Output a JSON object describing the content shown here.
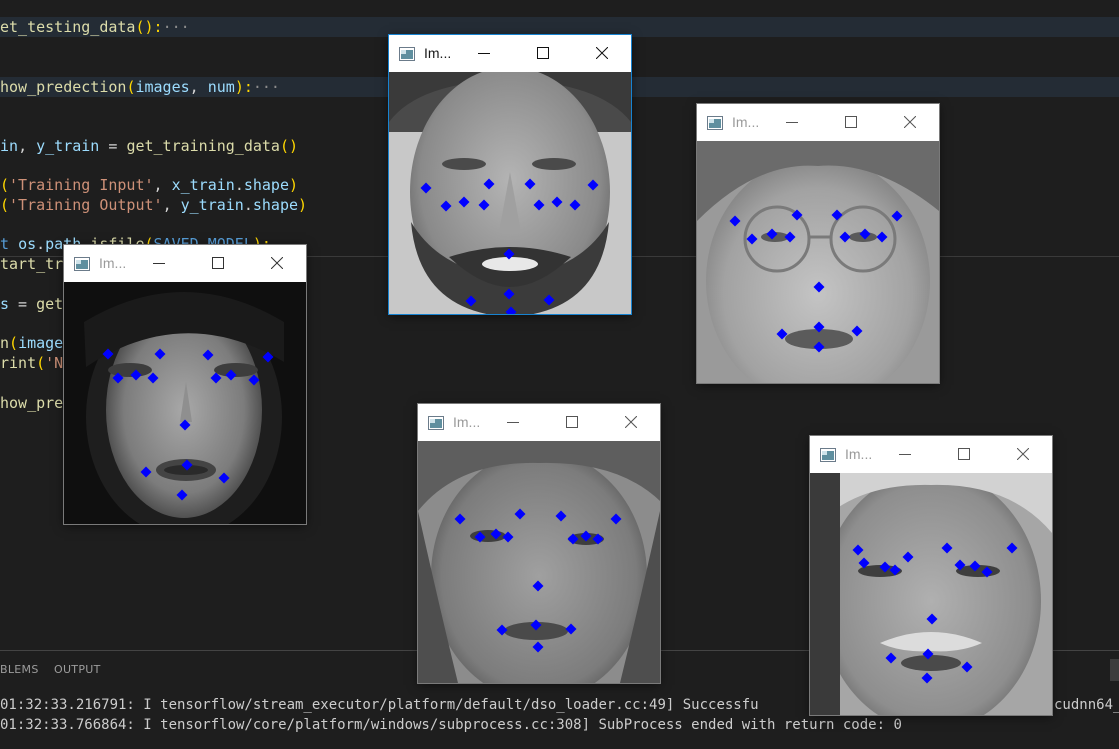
{
  "editor": {
    "lines": [
      {
        "parts": [
          {
            "t": "et_testing_data",
            "c": "fn"
          },
          {
            "t": "():",
            "c": "pn"
          },
          {
            "t": "···",
            "c": "fold"
          }
        ]
      },
      {
        "parts": [
          {
            "t": "how_predection",
            "c": "fn"
          },
          {
            "t": "(",
            "c": "pn"
          },
          {
            "t": "images",
            "c": "var"
          },
          {
            "t": ", ",
            "c": "txt"
          },
          {
            "t": "num",
            "c": "var"
          },
          {
            "t": "):",
            "c": "pn"
          },
          {
            "t": "···",
            "c": "fold"
          }
        ]
      },
      {
        "parts": [
          {
            "t": "in",
            "c": "var"
          },
          {
            "t": ", ",
            "c": "txt"
          },
          {
            "t": "y_train",
            "c": "var"
          },
          {
            "t": " = ",
            "c": "txt"
          },
          {
            "t": "get_training_data",
            "c": "fn"
          },
          {
            "t": "()",
            "c": "pn"
          }
        ]
      },
      {
        "parts": [
          {
            "t": "(",
            "c": "pn"
          },
          {
            "t": "'Training Input'",
            "c": "str"
          },
          {
            "t": ", ",
            "c": "txt"
          },
          {
            "t": "x_train",
            "c": "var"
          },
          {
            "t": ".",
            "c": "txt"
          },
          {
            "t": "shape",
            "c": "var"
          },
          {
            "t": ")",
            "c": "pn"
          }
        ]
      },
      {
        "parts": [
          {
            "t": "(",
            "c": "pn"
          },
          {
            "t": "'Training Output'",
            "c": "str"
          },
          {
            "t": ", ",
            "c": "txt"
          },
          {
            "t": "y_train",
            "c": "var"
          },
          {
            "t": ".",
            "c": "txt"
          },
          {
            "t": "shape",
            "c": "var"
          },
          {
            "t": ")",
            "c": "pn"
          }
        ]
      },
      {
        "parts": [
          {
            "t": "t ",
            "c": "bl"
          },
          {
            "t": "os",
            "c": "var"
          },
          {
            "t": ".",
            "c": "txt"
          },
          {
            "t": "path",
            "c": "var"
          },
          {
            "t": ".",
            "c": "txt"
          },
          {
            "t": "isfile",
            "c": "fn"
          },
          {
            "t": "(",
            "c": "pn"
          },
          {
            "t": "SAVED_MODEL",
            "c": "bl"
          },
          {
            "t": "):",
            "c": "pn"
          }
        ]
      },
      {
        "parts": [
          {
            "t": "tart_tr",
            "c": "fn"
          }
        ]
      },
      {
        "parts": [
          {
            "t": "s",
            "c": "var"
          },
          {
            "t": " = ",
            "c": "txt"
          },
          {
            "t": "get",
            "c": "fn"
          }
        ]
      },
      {
        "parts": [
          {
            "t": "n",
            "c": "fn"
          },
          {
            "t": "(",
            "c": "pn"
          },
          {
            "t": "image",
            "c": "var"
          }
        ]
      },
      {
        "parts": [
          {
            "t": "rint",
            "c": "fn"
          },
          {
            "t": "(",
            "c": "pn"
          },
          {
            "t": "'N",
            "c": "str"
          }
        ]
      },
      {
        "parts": [
          {
            "t": "how_pre",
            "c": "fn"
          }
        ]
      }
    ]
  },
  "panel": {
    "tabs": [
      "BLEMS",
      "OUTPUT"
    ],
    "terminal_lines": [
      "01:32:33.216791: I tensorflow/stream_executor/platform/default/dso_loader.cc:49] Successfu",
      "01:32:33.766864: I tensorflow/core/platform/windows/subprocess.cc:308] SubProcess ended with return code: 0"
    ],
    "terminal_tail": "cudnn64_"
  },
  "windows": [
    {
      "title": "Im..."
    },
    {
      "title": "Im..."
    },
    {
      "title": "Im..."
    },
    {
      "title": "Im..."
    },
    {
      "title": "Im..."
    }
  ],
  "colors": {
    "keypoint": "#0000ff",
    "active_border": "#1783d1"
  },
  "icons": {
    "app": "image-window-icon",
    "minimize": "minimize-icon",
    "maximize": "maximize-icon",
    "close": "close-icon"
  }
}
